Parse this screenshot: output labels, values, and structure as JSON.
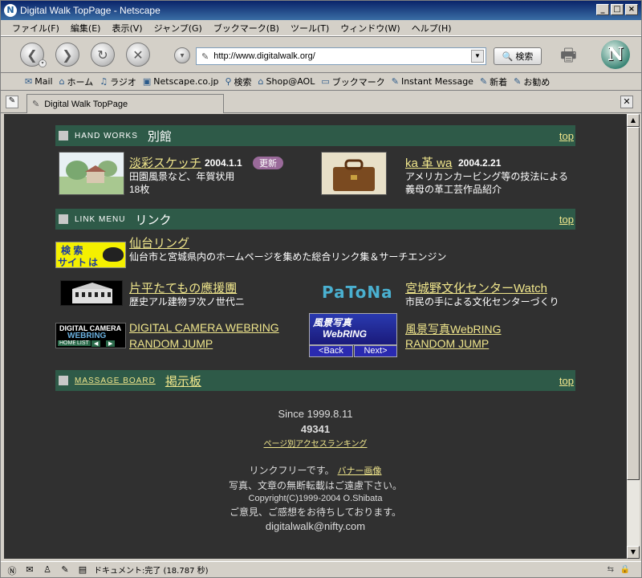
{
  "window": {
    "title": "Digital Walk TopPage - Netscape",
    "icon": "N"
  },
  "menu": [
    "ファイル(F)",
    "編集(E)",
    "表示(V)",
    "ジャンプ(G)",
    "ブックマーク(B)",
    "ツール(T)",
    "ウィンドウ(W)",
    "ヘルプ(H)"
  ],
  "nav": {
    "url": "http://www.digitalwalk.org/",
    "search_label": "検索",
    "logo": "N"
  },
  "personal": [
    "Mail",
    "ホーム",
    "ラジオ",
    "Netscape.co.jp",
    "検索",
    "Shop@AOL",
    "ブックマーク",
    "Instant Message",
    "新着",
    "お勧め"
  ],
  "tab": {
    "title": "Digital Walk TopPage"
  },
  "sections": {
    "hand": {
      "en": "HAND WORKS",
      "jp": "別館",
      "top": "top"
    },
    "link": {
      "en": "LINK MENU",
      "jp": "リンク",
      "top": "top"
    },
    "board": {
      "en": "MASSAGE BOARD",
      "jp": "掲示板",
      "top": "top"
    }
  },
  "hand": {
    "sketch": {
      "title": "淡彩スケッチ",
      "date": "2004.1.1",
      "badge": "更新",
      "desc1": "田園風景など、年賀状用",
      "desc2": "18枚"
    },
    "kawa": {
      "title": "ka 革 wa",
      "date": "2004.2.21",
      "desc1": "アメリカンカービング等の技法による",
      "desc2": "義母の革工芸作品紹介"
    }
  },
  "links": {
    "sendai": {
      "banner1": "検 索",
      "banner2": "サイト",
      "banner3": "は",
      "title": "仙台リング",
      "desc": "仙台市と宮城県内のホームページを集めた総合リンク集＆サーチエンジン"
    },
    "katahira": {
      "title": "片平たてもの應援團",
      "desc": "歴史アル建物ヲ次ノ世代ニ"
    },
    "patona": {
      "logo": "PaToNa",
      "title": "宮城野文化センターWatch",
      "desc": "市民の手による文化センターづくり"
    },
    "camera": {
      "banner1": "DIGITAL CAMERA",
      "banner2": "WEBRING",
      "banner3": "HOME",
      "banner4": "LIST",
      "title": "DIGITAL CAMERA WEBRING",
      "random": "RANDOM JUMP"
    },
    "fukei": {
      "banner1": "風景写真",
      "banner2": "WebRING",
      "back": "<Back",
      "next": "Next>",
      "title": "風景写真WebRING",
      "random": "RANDOM JUMP"
    }
  },
  "footer": {
    "since": "Since 1999.8.11",
    "count": "49341",
    "ranking": "ページ別アクセスランキング",
    "linkfree": "リンクフリーです。",
    "banner": "バナー画像",
    "copyline": "写真、文章の無断転載はご遠慮下さい。",
    "copyright": "Copyright(C)1999-2004 O.Shibata",
    "comments": "ご意見、ご感想をお待ちしております。",
    "email": "digitalwalk@nifty.com"
  },
  "status": {
    "text": "ドキュメント:完了 (18.787 秒)"
  }
}
